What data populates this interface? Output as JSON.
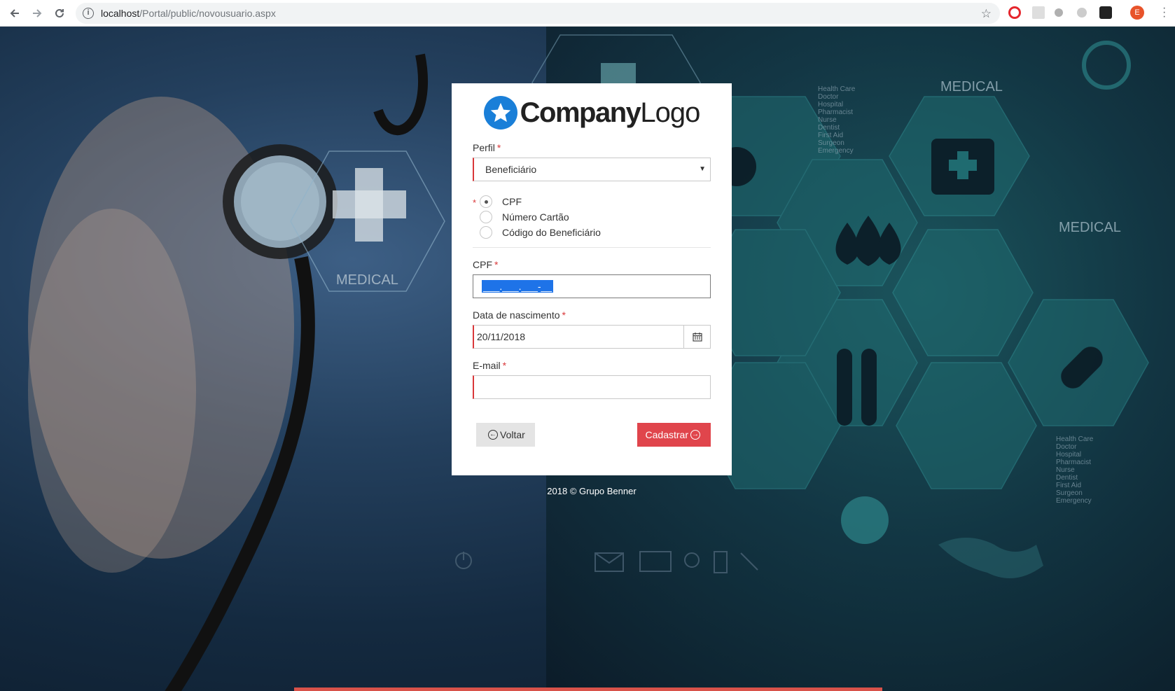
{
  "browser": {
    "url_host": "localhost",
    "url_path": "/Portal/public/novousuario.aspx",
    "profile_initial": "E"
  },
  "logo": {
    "brand_bold": "Company",
    "brand_light": "Logo"
  },
  "form": {
    "perfil": {
      "label": "Perfil",
      "value": "Beneficiário"
    },
    "id_type_options": [
      "CPF",
      "Número Cartão",
      "Código do Beneficiário"
    ],
    "id_type_selected": "CPF",
    "cpf": {
      "label": "CPF",
      "value": "___.___.___-__"
    },
    "birth_date": {
      "label": "Data de nascimento",
      "value": "20/11/2018"
    },
    "email": {
      "label": "E-mail",
      "value": ""
    },
    "required_mark": "*",
    "back_label": "Voltar",
    "submit_label": "Cadastrar"
  },
  "footer": {
    "text": "2018 © Grupo Benner"
  },
  "background": {
    "texts": [
      "MEDICAL",
      "MEDICAL",
      "MEDICAL"
    ],
    "legend_lines": [
      "Health Care",
      "Doctor",
      "Hospital",
      "Pharmacist",
      "Nurse",
      "Dentist",
      "First Aid",
      "Surgeon",
      "Emergency"
    ]
  },
  "colors": {
    "accent": "#e0454c",
    "required": "#d9383a",
    "logo_blue": "#1a7fd8",
    "selection": "#1e73e8"
  }
}
